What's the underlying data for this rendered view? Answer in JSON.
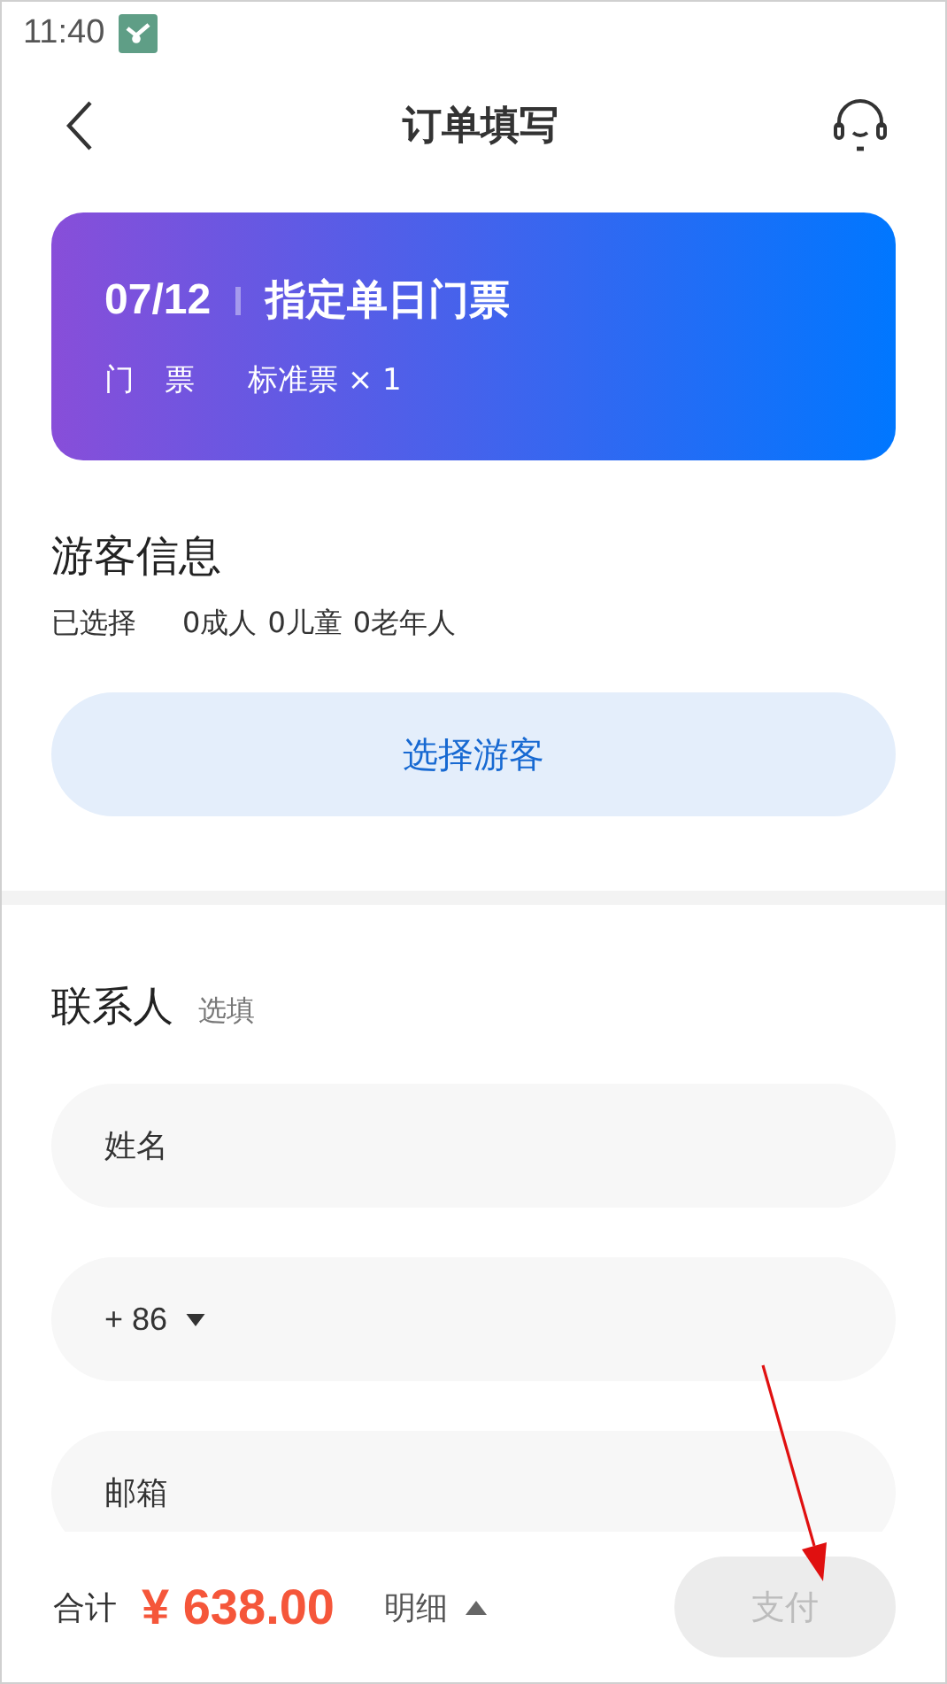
{
  "status_bar": {
    "time": "11:40"
  },
  "header": {
    "title": "订单填写"
  },
  "ticket": {
    "date": "07/12",
    "name": "指定单日门票",
    "label": "门　票",
    "value": "标准票 × 1"
  },
  "visitors": {
    "title": "游客信息",
    "selected_label": "已选择",
    "counts": [
      "0成人",
      "0儿童",
      "0老年人"
    ],
    "button": "选择游客"
  },
  "contact": {
    "title": "联系人",
    "tag": "选填",
    "fields": [
      {
        "kind": "text",
        "placeholder": "姓名"
      },
      {
        "kind": "phone",
        "prefix": "+ 86"
      },
      {
        "kind": "text",
        "placeholder": "邮箱"
      }
    ]
  },
  "footer": {
    "total_label": "合计",
    "amount": "¥ 638.00",
    "detail": "明细",
    "pay_button": {
      "label": "支付",
      "disabled": true
    }
  }
}
